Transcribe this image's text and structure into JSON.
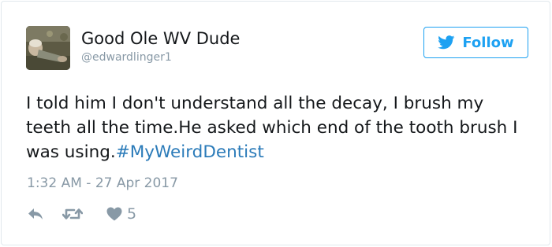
{
  "user": {
    "display_name": "Good Ole WV Dude",
    "handle": "@edwardlinger1",
    "avatar_icon": "user-photo-avatar"
  },
  "follow_button": {
    "label": "Follow",
    "icon": "twitter-bird-icon"
  },
  "tweet": {
    "text": "I told him I don't understand all the decay, I brush my teeth all the time.He asked which end of the tooth brush I was using.",
    "hashtag": "#MyWeirdDentist",
    "timestamp": "1:32 AM - 27 Apr 2017"
  },
  "actions": {
    "reply_icon": "reply-icon",
    "retweet_icon": "retweet-icon",
    "like_icon": "heart-icon",
    "like_count": "5"
  },
  "colors": {
    "brand_blue": "#1da1f2",
    "hashtag_blue": "#2b7bb9",
    "muted_gray": "#8899a6",
    "text_dark": "#14171a",
    "border": "#e1e8ed"
  }
}
